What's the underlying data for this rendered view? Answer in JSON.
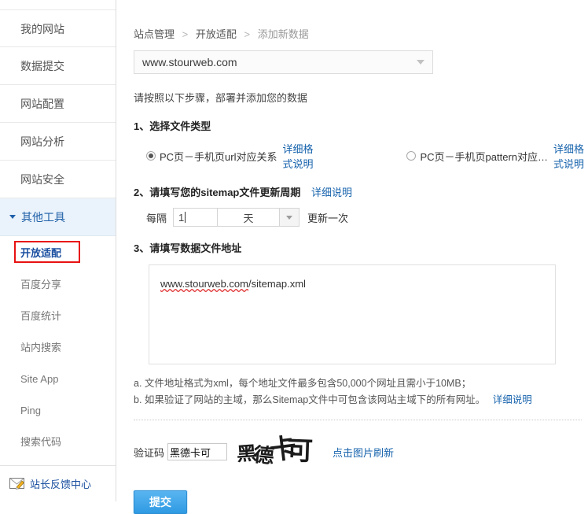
{
  "sidebar": {
    "items": [
      {
        "label": "我的网站"
      },
      {
        "label": "数据提交"
      },
      {
        "label": "网站配置"
      },
      {
        "label": "网站分析"
      },
      {
        "label": "网站安全"
      }
    ],
    "expanded_group": {
      "label": "其他工具"
    },
    "sub_items": [
      {
        "label": "开放适配",
        "active": true
      },
      {
        "label": "百度分享",
        "active": false
      },
      {
        "label": "百度统计",
        "active": false
      },
      {
        "label": "站内搜索",
        "active": false
      },
      {
        "label": "Site App",
        "active": false
      },
      {
        "label": "Ping",
        "active": false
      },
      {
        "label": "搜索代码",
        "active": false
      }
    ],
    "feedback": {
      "label": "站长反馈中心",
      "icon": "envelope-pencil-icon"
    },
    "highlight_color": "#e81111",
    "active_color": "#1a4fa0"
  },
  "breadcrumb": {
    "root": "站点管理",
    "section": "开放适配",
    "current": "添加新数据",
    "separator": ">"
  },
  "site_select": {
    "value": "www.stourweb.com",
    "icon": "chevron-down-icon"
  },
  "main": {
    "intro": "请按照以下步骤，部署并添加您的数据",
    "step1": {
      "title": "1、选择文件类型",
      "options": [
        {
          "label": "PC页－手机页url对应关系",
          "link": "详细格式说明",
          "checked": true
        },
        {
          "label": "PC页－手机页pattern对应…",
          "link": "详细格式说明",
          "checked": false
        }
      ]
    },
    "step2": {
      "title": "2、请填写您的sitemap文件更新周期",
      "link": "详细说明",
      "prefix": "每隔",
      "value": "1",
      "unit": "天",
      "suffix": "更新一次"
    },
    "step3": {
      "title": "3、请填写数据文件地址",
      "textarea_value_underlined": "www.stourweb.com",
      "textarea_value_rest": "/sitemap.xml"
    },
    "notes": [
      "a. 文件地址格式为xml，每个地址文件最多包含50,000个网址且需小于10MB；",
      "b. 如果验证了网站的主域，那么Sitemap文件中可包含该网站主域下的所有网址。"
    ],
    "notes_link": "详细说明",
    "captcha": {
      "label": "验证码",
      "value": "黑德卡可",
      "image_chars": [
        "黑",
        "德",
        "卡",
        "可"
      ],
      "refresh_label": "点击图片刷新"
    },
    "submit_label": "提交"
  }
}
